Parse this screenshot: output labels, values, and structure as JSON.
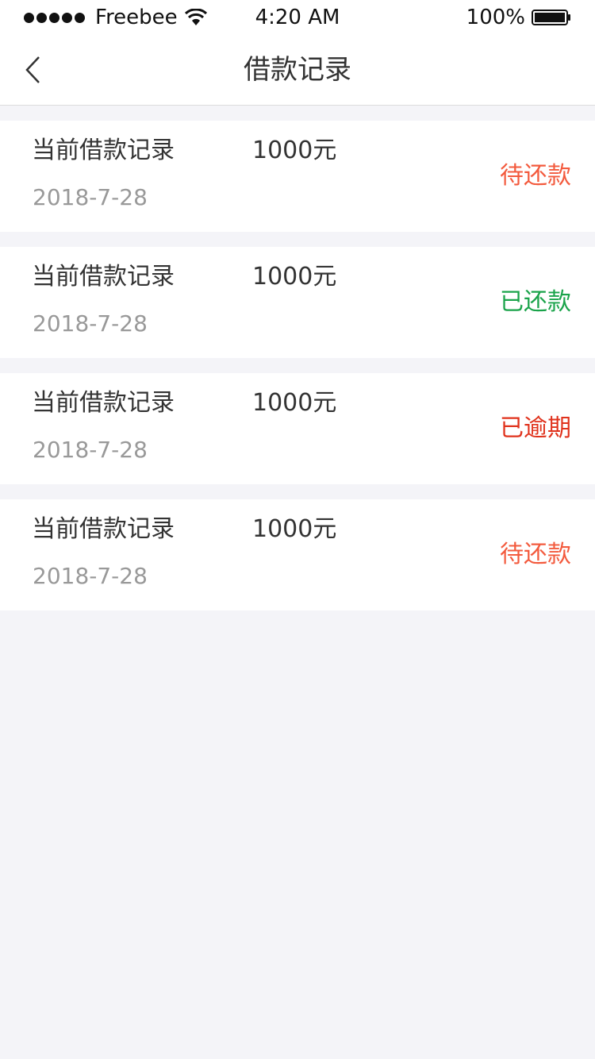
{
  "status_bar": {
    "carrier": "Freebee",
    "time": "4:20 AM",
    "battery": "100%"
  },
  "nav": {
    "title": "借款记录",
    "back_icon": "chevron-left-icon"
  },
  "records": [
    {
      "title": "当前借款记录",
      "amount": "1000元",
      "date": "2018-7-28",
      "status": "待还款",
      "status_color": "#f35a3d"
    },
    {
      "title": "当前借款记录",
      "amount": "1000元",
      "date": "2018-7-28",
      "status": "已还款",
      "status_color": "#1aa34a"
    },
    {
      "title": "当前借款记录",
      "amount": "1000元",
      "date": "2018-7-28",
      "status": "已逾期",
      "status_color": "#e0321c"
    },
    {
      "title": "当前借款记录",
      "amount": "1000元",
      "date": "2018-7-28",
      "status": "待还款",
      "status_color": "#f35a3d"
    }
  ]
}
